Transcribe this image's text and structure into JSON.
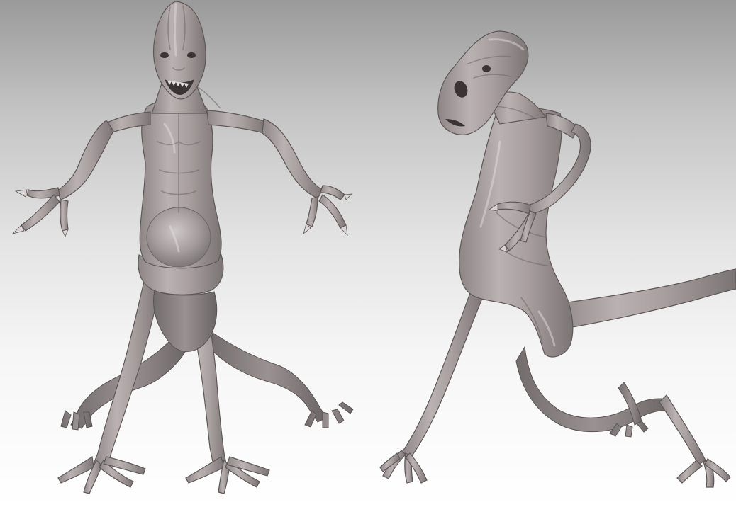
{
  "scene": {
    "subject_front": "creature-front-view",
    "subject_side": "creature-side-view",
    "colors": {
      "skin_light": "#b8b0b0",
      "skin_mid": "#9c9494",
      "skin_shadow": "#6e6767",
      "background_top": "#9a9a9a",
      "background_bottom": "#ffffff"
    }
  }
}
